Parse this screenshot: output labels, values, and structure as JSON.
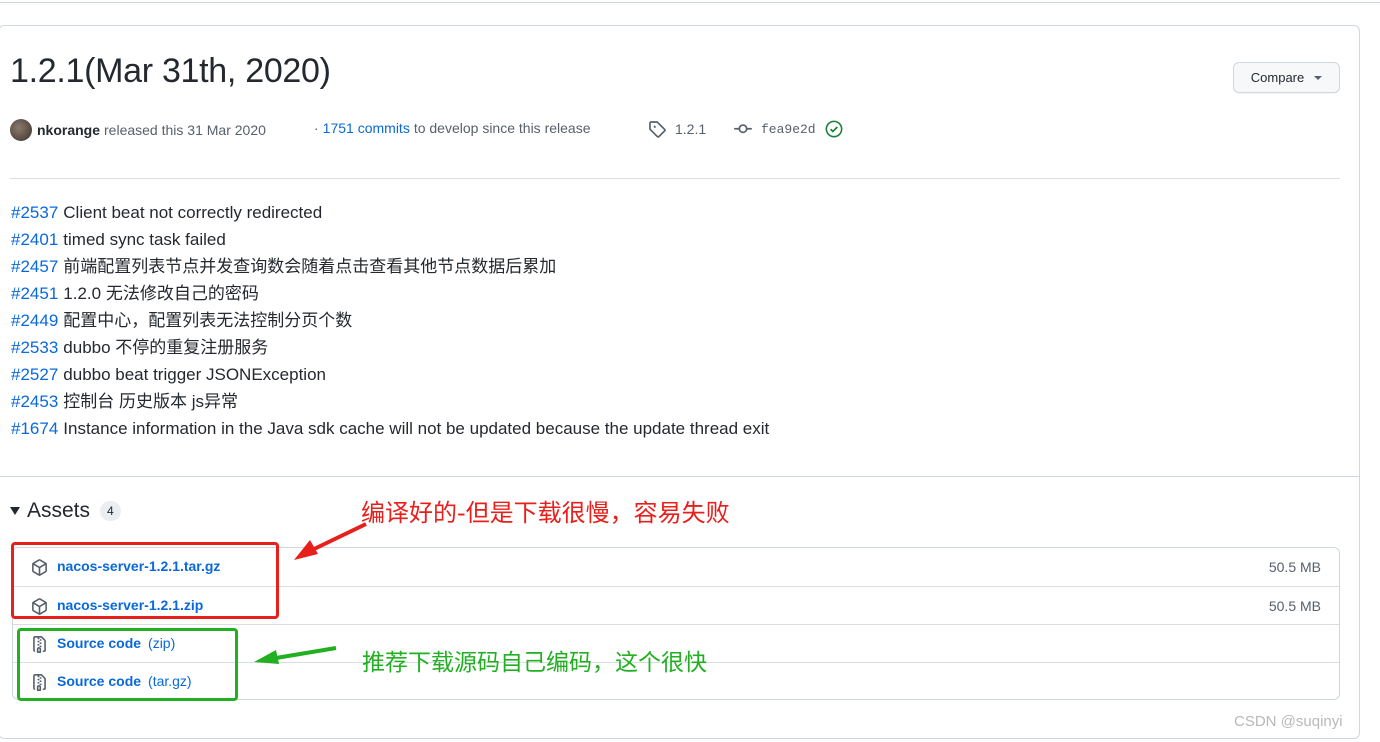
{
  "release": {
    "title": "1.2.1(Mar 31th, 2020)",
    "compare_label": "Compare",
    "author": "nkorange",
    "released_text": "released this 31 Mar 2020",
    "commits_prefix": "·",
    "commits_link": "1751 commits",
    "commits_suffix": "to develop since this release",
    "tag": "1.2.1",
    "commit_sha": "fea9e2d"
  },
  "notes": [
    {
      "issue": "#2537",
      "text": "Client beat not correctly redirected"
    },
    {
      "issue": "#2401",
      "text": "timed sync task failed"
    },
    {
      "issue": "#2457",
      "text": "前端配置列表节点并发查询数会随着点击查看其他节点数据后累加"
    },
    {
      "issue": "#2451",
      "text": "1.2.0 无法修改自己的密码"
    },
    {
      "issue": "#2449",
      "text": "配置中心，配置列表无法控制分页个数"
    },
    {
      "issue": "#2533",
      "text": "dubbo 不停的重复注册服务"
    },
    {
      "issue": "#2527",
      "text": "dubbo beat trigger JSONException"
    },
    {
      "issue": "#2453",
      "text": "控制台 历史版本 js异常"
    },
    {
      "issue": "#1674",
      "text": "Instance information in the Java sdk cache will not be updated because the update thread exit"
    }
  ],
  "assets": {
    "heading": "Assets",
    "count": "4",
    "items": [
      {
        "name": "nacos-server-1.2.1.tar.gz",
        "format": "",
        "size": "50.5 MB",
        "icon": "package-icon"
      },
      {
        "name": "nacos-server-1.2.1.zip",
        "format": "",
        "size": "50.5 MB",
        "icon": "package-icon"
      },
      {
        "name": "Source code",
        "format": "(zip)",
        "size": "",
        "icon": "file-zip-icon"
      },
      {
        "name": "Source code",
        "format": "(tar.gz)",
        "size": "",
        "icon": "file-zip-icon"
      }
    ]
  },
  "annotations": {
    "red_text": "编译好的-但是下载很慢，容易失败",
    "green_text": "推荐下载源码自己编码，这个很快",
    "red_color": "#e8201c",
    "green_color": "#22b022"
  },
  "watermark": "CSDN @suqinyi",
  "colors": {
    "link": "#0969da",
    "text": "#24292f",
    "muted": "#57606a",
    "verified": "#1a7f37"
  }
}
